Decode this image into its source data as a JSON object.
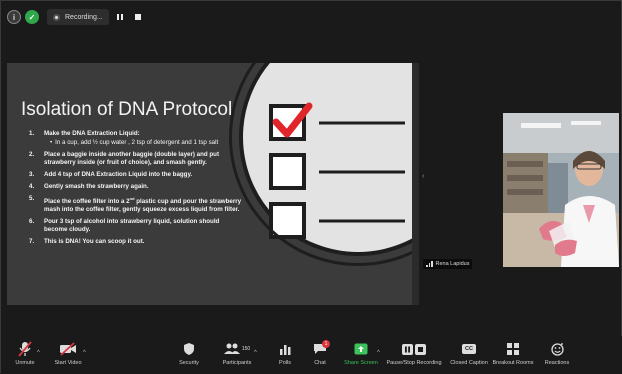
{
  "top_bar": {
    "recording_label": "Recording..."
  },
  "slide": {
    "title": "Isolation of DNA Protocol",
    "steps": [
      {
        "num": "1.",
        "text": "Make the DNA Extraction Liquid:",
        "sub": "In a cup, add ½ cup water , 2 tsp of detergent and 1 tsp salt"
      },
      {
        "num": "2.",
        "text": "Place a baggie inside another baggie (double layer) and put strawberry inside (or fruit of choice), and smash gently."
      },
      {
        "num": "3.",
        "text": "Add 4 tsp of DNA Extraction Liquid into the baggy."
      },
      {
        "num": "4.",
        "text": "Gently smash the strawberry again."
      },
      {
        "num": "5.",
        "text_before": "Place the coffee filter into a 2",
        "sup": "nd",
        "text_after": " plastic cup and pour the strawberry mash into the coffee filter, gently squeeze excess liquid from filter."
      },
      {
        "num": "6.",
        "text": "Pour 3 tsp of alcohol into strawberry liquid, solution should become cloudy."
      },
      {
        "num": "7.",
        "text": "This is DNA! You can scoop it out."
      }
    ]
  },
  "participant": {
    "name": "Rena Lapidus"
  },
  "toolbar": {
    "unmute": "Unmute",
    "start_video": "Start Video",
    "security": "Security",
    "participants": "Participants",
    "participants_count": "150",
    "polls": "Polls",
    "chat": "Chat",
    "chat_badge": "1",
    "share_screen": "Share Screen",
    "pause_stop_recording": "Pause/Stop Recording",
    "closed_caption": "Closed Caption",
    "cc_icon_text": "CC",
    "breakout_rooms": "Breakout Rooms",
    "reactions": "Reactions"
  },
  "colors": {
    "share_green": "#3bc25a",
    "check_red": "#e0252b",
    "alert_red": "#d9363e"
  }
}
